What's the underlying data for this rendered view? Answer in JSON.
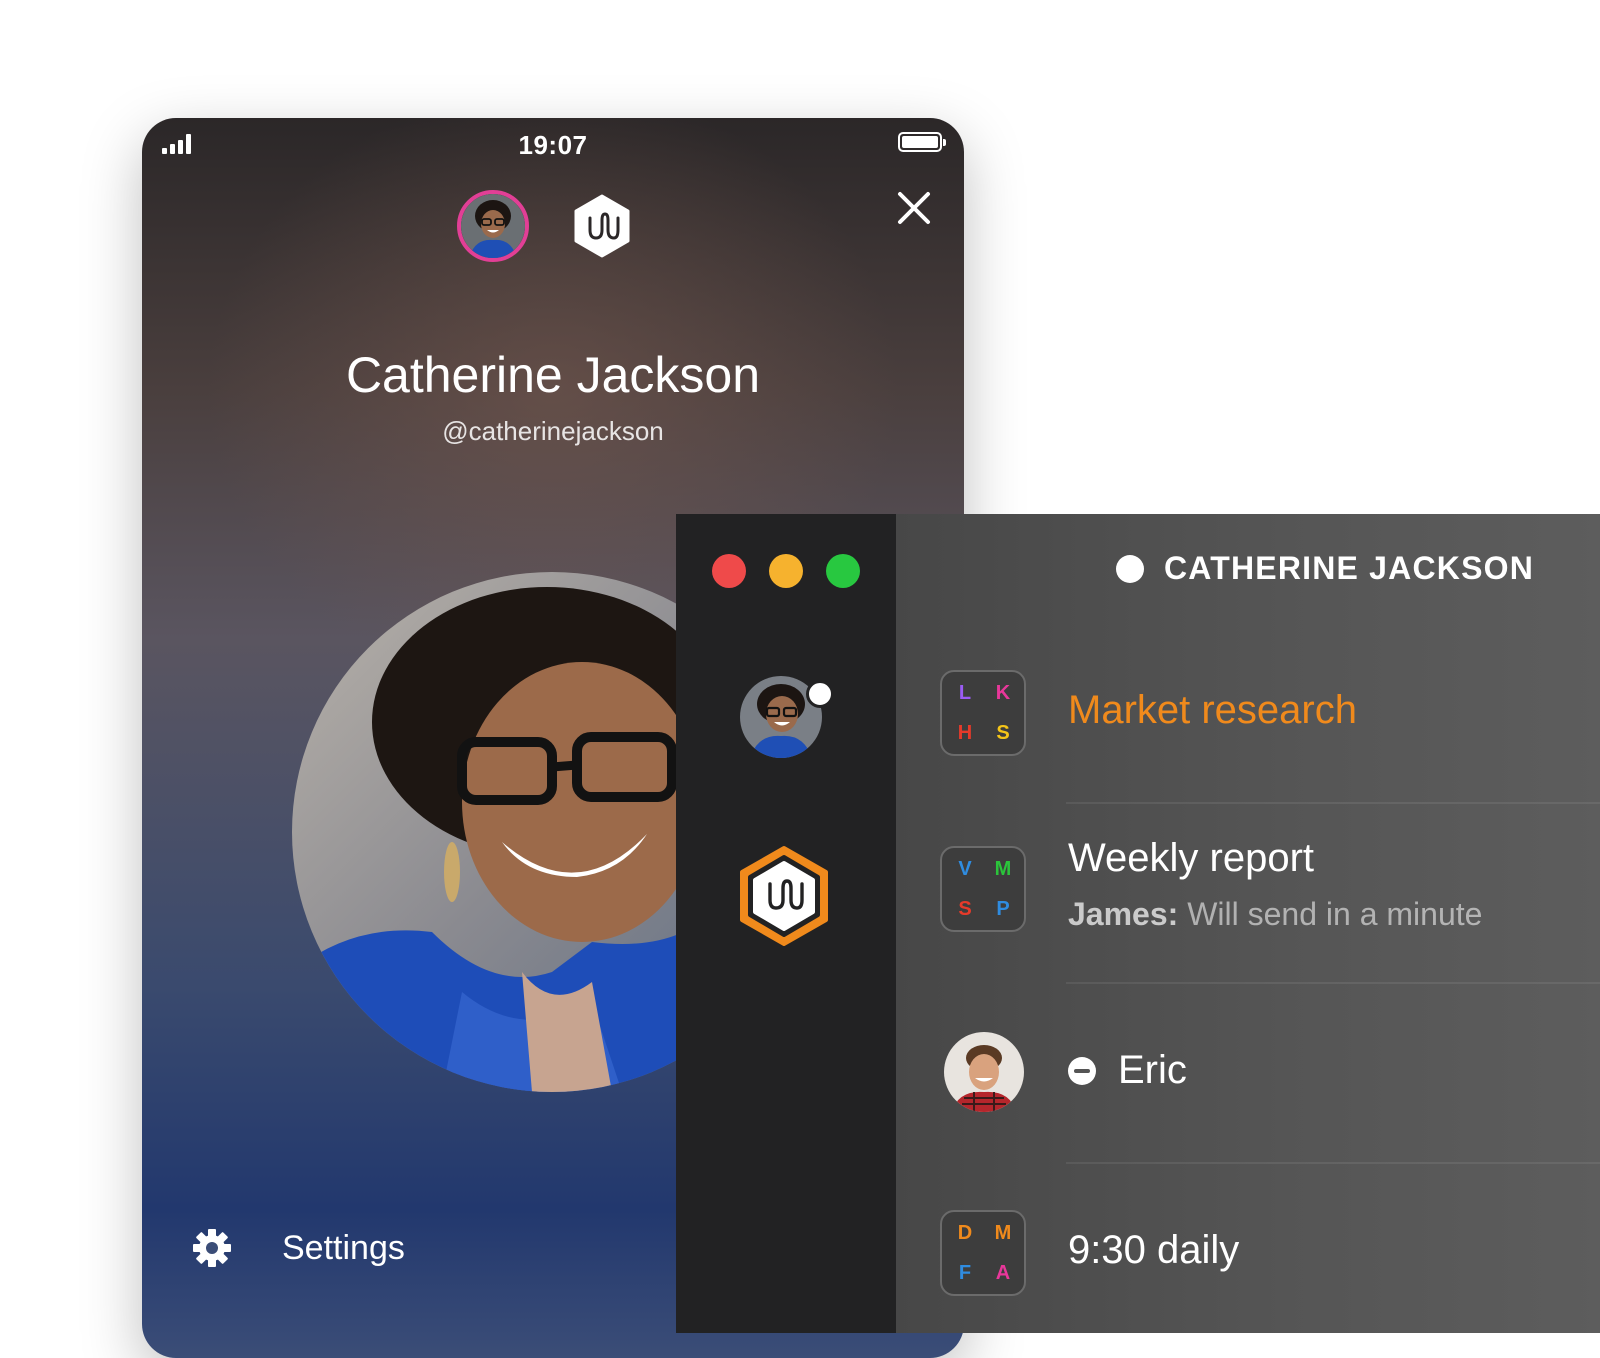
{
  "phone": {
    "time": "19:07",
    "profile_name": "Catherine Jackson",
    "handle": "@catherinejackson",
    "settings_label": "Settings",
    "icons": {
      "signal": "signal-icon",
      "battery": "battery-icon",
      "close": "close-icon",
      "app": "wire-logo-icon",
      "settings": "gear-icon"
    },
    "accent_ring_color": "#e23f96"
  },
  "desktop": {
    "traffic_lights": [
      "#ef4a4a",
      "#f6b22e",
      "#28c840"
    ],
    "header_name": "CATHERINE JACKSON",
    "sidebar_accent_color": "#f08a1c",
    "conversations": [
      {
        "title": "Market research",
        "title_color": "#f08a1c",
        "initials": [
          {
            "letter": "L",
            "color": "#9b5cf5"
          },
          {
            "letter": "K",
            "color": "#e8379a"
          },
          {
            "letter": "H",
            "color": "#e63a2a"
          },
          {
            "letter": "S",
            "color": "#f5c518"
          }
        ]
      },
      {
        "title": "Weekly report",
        "sender": "James:",
        "preview": " Will send in a minute",
        "initials": [
          {
            "letter": "V",
            "color": "#2f8ce0"
          },
          {
            "letter": "M",
            "color": "#2bc43b"
          },
          {
            "letter": "S",
            "color": "#e63a2a"
          },
          {
            "letter": "P",
            "color": "#2f8ce0"
          }
        ]
      },
      {
        "title": "Eric",
        "status_icon": "do-not-disturb-icon"
      },
      {
        "title": "9:30 daily",
        "initials": [
          {
            "letter": "D",
            "color": "#f08a1c"
          },
          {
            "letter": "M",
            "color": "#f08a1c"
          },
          {
            "letter": "F",
            "color": "#2f8ce0"
          },
          {
            "letter": "A",
            "color": "#e8379a"
          }
        ]
      }
    ]
  }
}
